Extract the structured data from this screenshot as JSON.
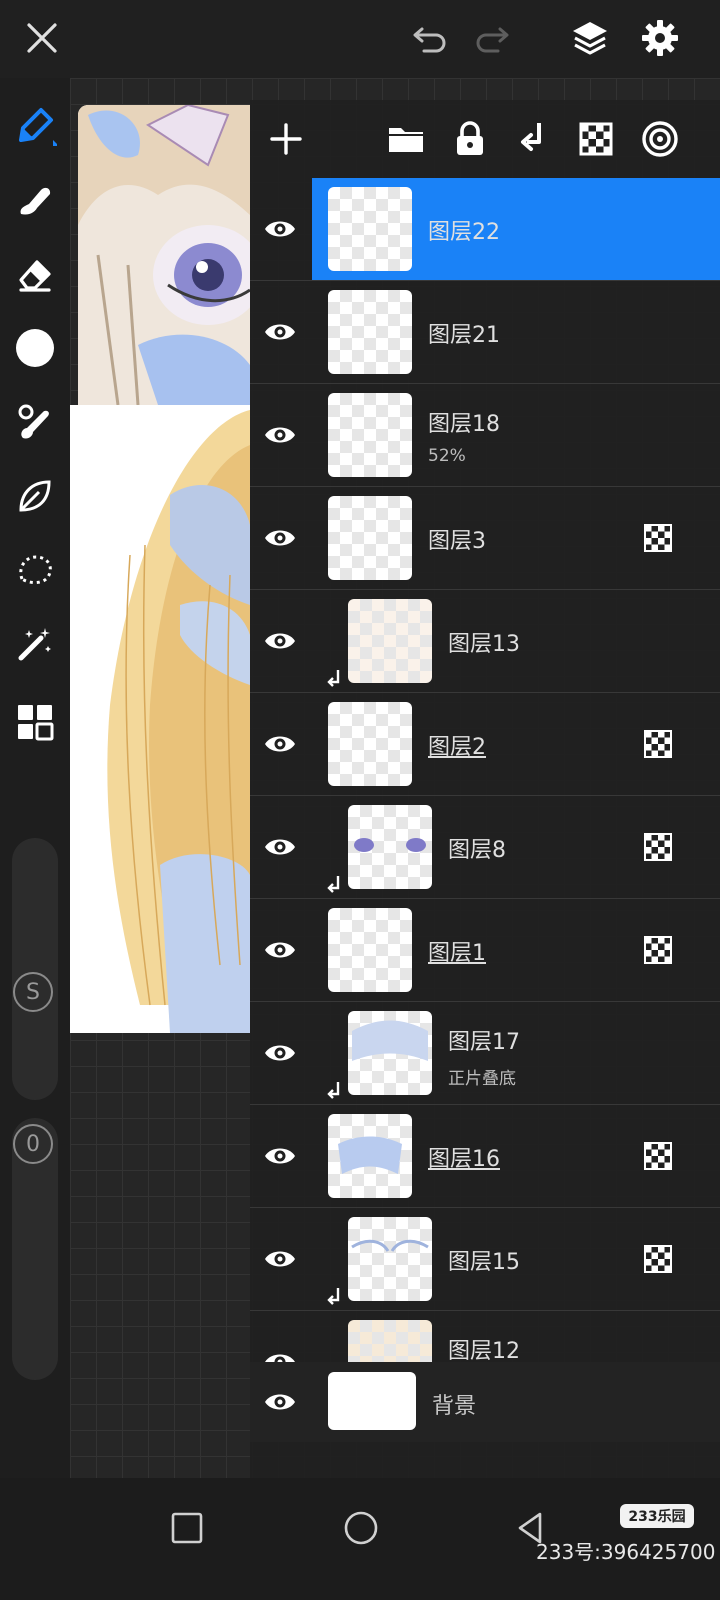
{
  "colors": {
    "accent": "#1a82f7",
    "panel": "#202020"
  },
  "topbar": {
    "icons": [
      "close-icon",
      "undo-icon",
      "redo-icon",
      "layers-icon",
      "settings-icon"
    ]
  },
  "toolbar": {
    "tools": [
      "brush-icon",
      "smudge-icon",
      "eraser-icon",
      "color-icon",
      "brush-library-icon",
      "shape-icon",
      "selection-icon",
      "magic-wand-icon",
      "grid-icon"
    ],
    "size_badge": "S",
    "opacity_badge": "0"
  },
  "layers_panel": {
    "header_icons": [
      "add-layer-icon",
      "folder-icon",
      "lock-icon",
      "clip-icon",
      "transparency-icon",
      "blend-icon"
    ],
    "layers": [
      {
        "name": "图层22",
        "sub": ""
      },
      {
        "name": "图层21",
        "sub": ""
      },
      {
        "name": "图层18",
        "sub": "52%"
      },
      {
        "name": "图层3",
        "sub": ""
      },
      {
        "name": "图层13",
        "sub": ""
      },
      {
        "name": "图层2",
        "sub": ""
      },
      {
        "name": "图层8",
        "sub": ""
      },
      {
        "name": "图层1",
        "sub": ""
      },
      {
        "name": "图层17",
        "sub": "正片叠底"
      },
      {
        "name": "图层16",
        "sub": ""
      },
      {
        "name": "图层15",
        "sub": ""
      },
      {
        "name": "图层12",
        "sub": ""
      }
    ],
    "background_layer": {
      "name": "背景"
    }
  },
  "bottom_nav": {
    "icons": [
      "recent-apps-icon",
      "home-icon",
      "back-icon"
    ]
  },
  "watermark": {
    "logo": "233乐园",
    "text": "233号:396425700"
  }
}
